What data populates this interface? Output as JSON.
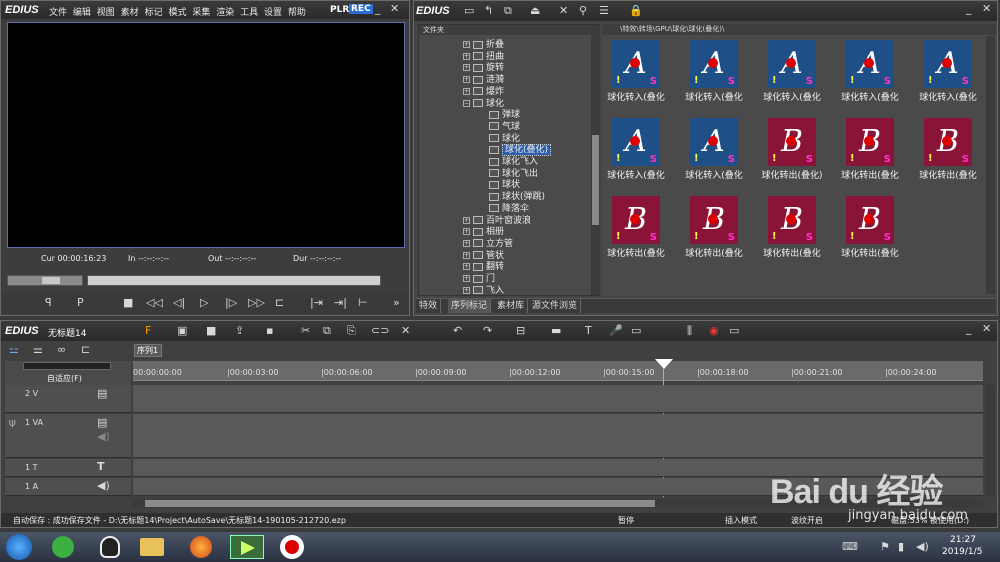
{
  "player": {
    "logo": "EDIUS",
    "menu": [
      "文件",
      "编辑",
      "视图",
      "素材",
      "标记",
      "模式",
      "采集",
      "渲染",
      "工具",
      "设置",
      "帮助"
    ],
    "plr": "PLR",
    "rec": "REC",
    "cur": "Cur 00:00:16:23",
    "in": "In --:--:--:--",
    "out": "Out --:--:--:--",
    "dur": "Dur --:--:--:--"
  },
  "bin": {
    "logo": "EDIUS",
    "folder_header": "文件夹",
    "path": "\\特效\\转场\\GPU\\球化\\球化(叠化)\\",
    "tree": [
      {
        "label": "折叠",
        "kind": "plus"
      },
      {
        "label": "扭曲",
        "kind": "plus"
      },
      {
        "label": "旋转",
        "kind": "plus"
      },
      {
        "label": "涟漪",
        "kind": "plus"
      },
      {
        "label": "爆炸",
        "kind": "plus"
      },
      {
        "label": "球化",
        "kind": "minus"
      },
      {
        "label": "弹球",
        "kind": "child"
      },
      {
        "label": "气球",
        "kind": "child"
      },
      {
        "label": "球化",
        "kind": "child"
      },
      {
        "label": "球化(叠化)",
        "kind": "selected"
      },
      {
        "label": "球化飞入",
        "kind": "child"
      },
      {
        "label": "球化飞出",
        "kind": "child"
      },
      {
        "label": "球状",
        "kind": "child"
      },
      {
        "label": "球状(弹跳)",
        "kind": "child"
      },
      {
        "label": "降落伞",
        "kind": "child"
      },
      {
        "label": "百叶窗波浪",
        "kind": "plus"
      },
      {
        "label": "相册",
        "kind": "plus"
      },
      {
        "label": "立方管",
        "kind": "plus"
      },
      {
        "label": "管状",
        "kind": "plus"
      },
      {
        "label": "翻转",
        "kind": "plus"
      },
      {
        "label": "门",
        "kind": "plus"
      },
      {
        "label": "飞入",
        "kind": "plus"
      }
    ],
    "tabs": [
      "特效",
      "序列标记",
      "素材库",
      "源文件浏览"
    ],
    "items": [
      {
        "letter": "A",
        "caption": "球化转入(叠化"
      },
      {
        "letter": "A",
        "caption": "球化转入(叠化"
      },
      {
        "letter": "A",
        "caption": "球化转入(叠化"
      },
      {
        "letter": "A",
        "caption": "球化转入(叠化"
      },
      {
        "letter": "A",
        "caption": "球化转入(叠化"
      },
      {
        "letter": "A",
        "caption": "球化转入(叠化"
      },
      {
        "letter": "A",
        "caption": "球化转入(叠化"
      },
      {
        "letter": "B",
        "caption": "球化转出(叠化)"
      },
      {
        "letter": "B",
        "caption": "球化转出(叠化"
      },
      {
        "letter": "B",
        "caption": "球化转出(叠化"
      },
      {
        "letter": "B",
        "caption": "球化转出(叠化"
      },
      {
        "letter": "B",
        "caption": "球化转出(叠化"
      },
      {
        "letter": "B",
        "caption": "球化转出(叠化"
      },
      {
        "letter": "B",
        "caption": "球化转出(叠化"
      }
    ]
  },
  "timeline": {
    "logo": "EDIUS",
    "project": "无标题14",
    "seq_tab": "序列1",
    "mode": "自适应(F)",
    "ruler": [
      "00:00:00:00",
      "|00:00:03:00",
      "|00:00:06:00",
      "|00:00:09:00",
      "|00:00:12:00",
      "|00:00:15:00",
      "|00:00:18:00",
      "|00:00:21:00",
      "|00:00:24:00"
    ],
    "tracks": [
      {
        "label": "2 V"
      },
      {
        "label": "1 VA"
      },
      {
        "label": "1 T"
      },
      {
        "label": "1 A"
      }
    ]
  },
  "status": {
    "autosave": "自动保存 : 成功保存文件 - D:\\无标题14\\Project\\AutoSave\\无标题14-190105-212720.ezp",
    "pause": "暂停",
    "insert": "插入模式",
    "ripple": "波纹开启",
    "disk": "磁盘:53% 被使用(D:)"
  },
  "taskbar": {
    "time": "21:27",
    "date": "2019/1/5"
  },
  "watermark": {
    "brand": "Bai du 经验",
    "url": "jingyan.baidu.com"
  },
  "colors": {
    "blueThumb": "#1e4f86",
    "redThumb": "#8a1438",
    "accent": "#3aa9e0"
  }
}
